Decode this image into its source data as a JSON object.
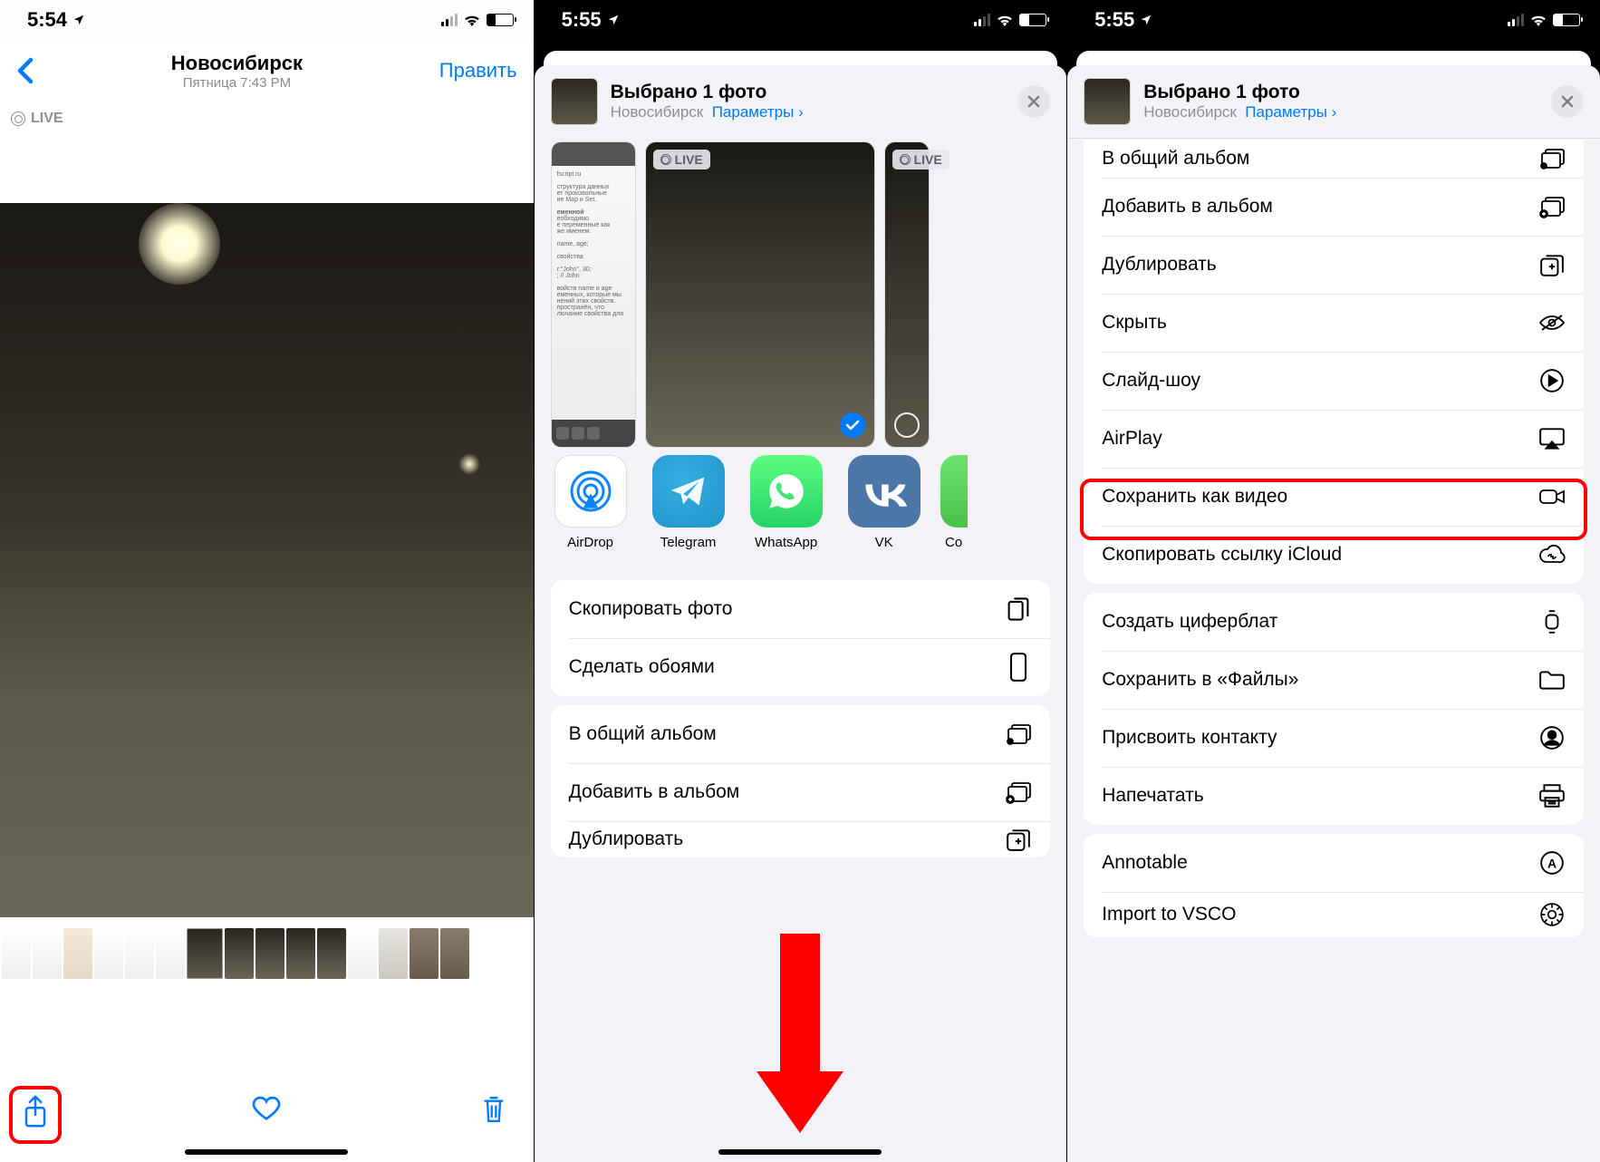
{
  "screen1": {
    "status_time": "5:54",
    "title": "Новосибирск",
    "subtitle": "Пятница 7:43 PM",
    "edit": "Править",
    "live": "LIVE"
  },
  "screen2": {
    "status_time": "5:55",
    "sheet_title": "Выбрано 1 фото",
    "location": "Новосибирск",
    "params": "Параметры",
    "live": "LIVE",
    "apps": [
      {
        "label": "AirDrop"
      },
      {
        "label": "Telegram"
      },
      {
        "label": "WhatsApp"
      },
      {
        "label": "VK"
      },
      {
        "label": "Co"
      }
    ],
    "group1": [
      {
        "label": "Скопировать фото",
        "icon": "copy"
      },
      {
        "label": "Сделать обоями",
        "icon": "phone"
      }
    ],
    "group2": [
      {
        "label": "В общий альбом",
        "icon": "shared-album"
      },
      {
        "label": "Добавить в альбом",
        "icon": "add-album"
      },
      {
        "label": "Дублировать",
        "icon": "duplicate"
      }
    ]
  },
  "screen3": {
    "status_time": "5:55",
    "sheet_title": "Выбрано 1 фото",
    "location": "Новосибирск",
    "params": "Параметры",
    "group_a": [
      {
        "label": "В общий альбом",
        "icon": "shared-album"
      },
      {
        "label": "Добавить в альбом",
        "icon": "add-album"
      },
      {
        "label": "Дублировать",
        "icon": "duplicate"
      },
      {
        "label": "Скрыть",
        "icon": "hide"
      },
      {
        "label": "Слайд-шоу",
        "icon": "play"
      },
      {
        "label": "AirPlay",
        "icon": "airplay"
      },
      {
        "label": "Сохранить как видео",
        "icon": "video",
        "highlight": true
      },
      {
        "label": "Скопировать ссылку iCloud",
        "icon": "cloud-link"
      }
    ],
    "group_b": [
      {
        "label": "Создать циферблат",
        "icon": "watch"
      },
      {
        "label": "Сохранить в «Файлы»",
        "icon": "folder"
      },
      {
        "label": "Присвоить контакту",
        "icon": "contact"
      },
      {
        "label": "Напечатать",
        "icon": "print"
      }
    ],
    "group_c": [
      {
        "label": "Annotable",
        "icon": "annotable"
      },
      {
        "label": "Import to VSCO",
        "icon": "vsco"
      }
    ]
  }
}
